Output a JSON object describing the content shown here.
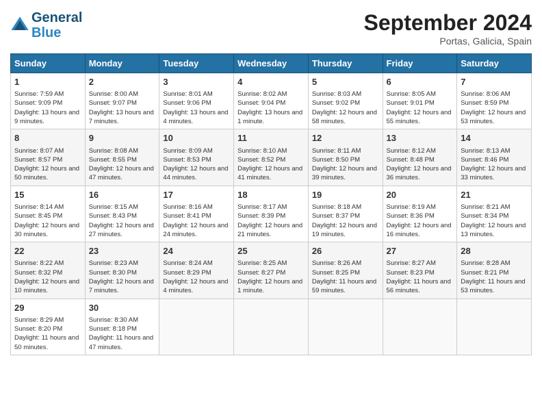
{
  "header": {
    "logo_line1": "General",
    "logo_line2": "Blue",
    "month": "September 2024",
    "location": "Portas, Galicia, Spain"
  },
  "days_of_week": [
    "Sunday",
    "Monday",
    "Tuesday",
    "Wednesday",
    "Thursday",
    "Friday",
    "Saturday"
  ],
  "weeks": [
    [
      {
        "day": "1",
        "text": "Sunrise: 7:59 AM\nSunset: 9:09 PM\nDaylight: 13 hours and 9 minutes."
      },
      {
        "day": "2",
        "text": "Sunrise: 8:00 AM\nSunset: 9:07 PM\nDaylight: 13 hours and 7 minutes."
      },
      {
        "day": "3",
        "text": "Sunrise: 8:01 AM\nSunset: 9:06 PM\nDaylight: 13 hours and 4 minutes."
      },
      {
        "day": "4",
        "text": "Sunrise: 8:02 AM\nSunset: 9:04 PM\nDaylight: 13 hours and 1 minute."
      },
      {
        "day": "5",
        "text": "Sunrise: 8:03 AM\nSunset: 9:02 PM\nDaylight: 12 hours and 58 minutes."
      },
      {
        "day": "6",
        "text": "Sunrise: 8:05 AM\nSunset: 9:01 PM\nDaylight: 12 hours and 55 minutes."
      },
      {
        "day": "7",
        "text": "Sunrise: 8:06 AM\nSunset: 8:59 PM\nDaylight: 12 hours and 53 minutes."
      }
    ],
    [
      {
        "day": "8",
        "text": "Sunrise: 8:07 AM\nSunset: 8:57 PM\nDaylight: 12 hours and 50 minutes."
      },
      {
        "day": "9",
        "text": "Sunrise: 8:08 AM\nSunset: 8:55 PM\nDaylight: 12 hours and 47 minutes."
      },
      {
        "day": "10",
        "text": "Sunrise: 8:09 AM\nSunset: 8:53 PM\nDaylight: 12 hours and 44 minutes."
      },
      {
        "day": "11",
        "text": "Sunrise: 8:10 AM\nSunset: 8:52 PM\nDaylight: 12 hours and 41 minutes."
      },
      {
        "day": "12",
        "text": "Sunrise: 8:11 AM\nSunset: 8:50 PM\nDaylight: 12 hours and 39 minutes."
      },
      {
        "day": "13",
        "text": "Sunrise: 8:12 AM\nSunset: 8:48 PM\nDaylight: 12 hours and 36 minutes."
      },
      {
        "day": "14",
        "text": "Sunrise: 8:13 AM\nSunset: 8:46 PM\nDaylight: 12 hours and 33 minutes."
      }
    ],
    [
      {
        "day": "15",
        "text": "Sunrise: 8:14 AM\nSunset: 8:45 PM\nDaylight: 12 hours and 30 minutes."
      },
      {
        "day": "16",
        "text": "Sunrise: 8:15 AM\nSunset: 8:43 PM\nDaylight: 12 hours and 27 minutes."
      },
      {
        "day": "17",
        "text": "Sunrise: 8:16 AM\nSunset: 8:41 PM\nDaylight: 12 hours and 24 minutes."
      },
      {
        "day": "18",
        "text": "Sunrise: 8:17 AM\nSunset: 8:39 PM\nDaylight: 12 hours and 21 minutes."
      },
      {
        "day": "19",
        "text": "Sunrise: 8:18 AM\nSunset: 8:37 PM\nDaylight: 12 hours and 19 minutes."
      },
      {
        "day": "20",
        "text": "Sunrise: 8:19 AM\nSunset: 8:36 PM\nDaylight: 12 hours and 16 minutes."
      },
      {
        "day": "21",
        "text": "Sunrise: 8:21 AM\nSunset: 8:34 PM\nDaylight: 12 hours and 13 minutes."
      }
    ],
    [
      {
        "day": "22",
        "text": "Sunrise: 8:22 AM\nSunset: 8:32 PM\nDaylight: 12 hours and 10 minutes."
      },
      {
        "day": "23",
        "text": "Sunrise: 8:23 AM\nSunset: 8:30 PM\nDaylight: 12 hours and 7 minutes."
      },
      {
        "day": "24",
        "text": "Sunrise: 8:24 AM\nSunset: 8:29 PM\nDaylight: 12 hours and 4 minutes."
      },
      {
        "day": "25",
        "text": "Sunrise: 8:25 AM\nSunset: 8:27 PM\nDaylight: 12 hours and 1 minute."
      },
      {
        "day": "26",
        "text": "Sunrise: 8:26 AM\nSunset: 8:25 PM\nDaylight: 11 hours and 59 minutes."
      },
      {
        "day": "27",
        "text": "Sunrise: 8:27 AM\nSunset: 8:23 PM\nDaylight: 11 hours and 56 minutes."
      },
      {
        "day": "28",
        "text": "Sunrise: 8:28 AM\nSunset: 8:21 PM\nDaylight: 11 hours and 53 minutes."
      }
    ],
    [
      {
        "day": "29",
        "text": "Sunrise: 8:29 AM\nSunset: 8:20 PM\nDaylight: 11 hours and 50 minutes."
      },
      {
        "day": "30",
        "text": "Sunrise: 8:30 AM\nSunset: 8:18 PM\nDaylight: 11 hours and 47 minutes."
      },
      {
        "day": "",
        "text": ""
      },
      {
        "day": "",
        "text": ""
      },
      {
        "day": "",
        "text": ""
      },
      {
        "day": "",
        "text": ""
      },
      {
        "day": "",
        "text": ""
      }
    ]
  ]
}
